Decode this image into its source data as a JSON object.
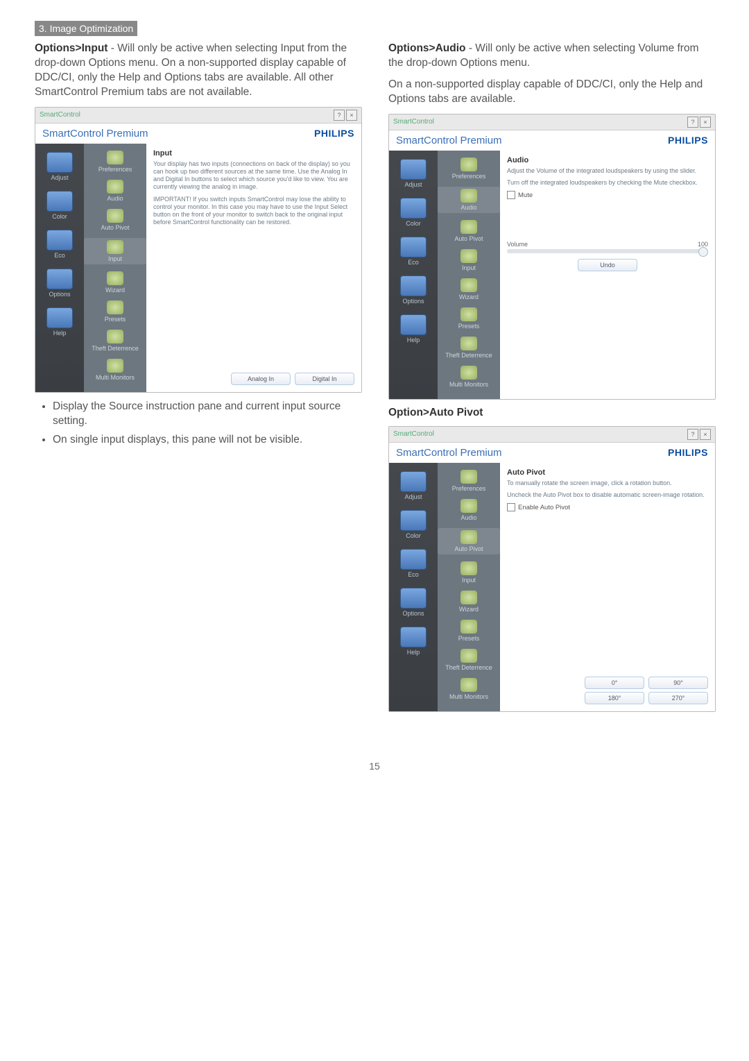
{
  "section_header": "3. Image Optimization",
  "left": {
    "heading_strong": "Options>Input",
    "heading_rest": " - Will only be active when selecting Input from the drop-down Options menu. On a non-supported display capable of DDC/CI, only the Help and Options tabs are available. All other SmartControl Premium tabs are not available.",
    "bullets": [
      "Display the Source instruction pane and current input source setting.",
      "On single input displays, this pane will not be visible."
    ],
    "screenshot": {
      "window_title": "SmartControl",
      "title": "SmartControl Premium",
      "brand": "PHILIPS",
      "leftnav": [
        "Adjust",
        "Color",
        "Eco",
        "Options",
        "Help"
      ],
      "midnav": [
        "Preferences",
        "Audio",
        "Auto Pivot",
        "Input",
        "Wizard",
        "Presets",
        "Theft Deterrence",
        "Multi Monitors"
      ],
      "panel_title": "Input",
      "panel_p1": "Your display has two inputs (connections on back of the display) so you can hook up two different sources at the same time. Use the Analog In and Digital In buttons to select which source you'd like to view. You are currently viewing the analog in image.",
      "panel_p2": "IMPORTANT! If you switch inputs SmartControl may lose the ability to control your monitor. In this case you may have to use the Input Select button on the front of your monitor to switch back to the original input before SmartControl functionality can be restored.",
      "buttons": [
        "Analog In",
        "Digital In"
      ]
    }
  },
  "right": {
    "heading_strong": "Options>Audio",
    "heading_rest": " - Will only be active when selecting Volume from the drop-down Options menu.",
    "para2": "On a non-supported display capable of DDC/CI, only the Help and Options tabs are available.",
    "screenshot_audio": {
      "window_title": "SmartControl",
      "title": "SmartControl Premium",
      "brand": "PHILIPS",
      "leftnav": [
        "Adjust",
        "Color",
        "Eco",
        "Options",
        "Help"
      ],
      "midnav": [
        "Preferences",
        "Audio",
        "Auto Pivot",
        "Input",
        "Wizard",
        "Presets",
        "Theft Deterrence",
        "Multi Monitors"
      ],
      "panel_title": "Audio",
      "panel_p1": "Adjust the Volume of the integrated loudspeakers by using the slider.",
      "panel_p2": "Turn off the integrated loudspeakers by checking the Mute checkbox.",
      "checkbox_label": "Mute",
      "slider_label": "Volume",
      "slider_value": "100",
      "undo_button": "Undo"
    },
    "sub_heading": "Option>Auto Pivot",
    "screenshot_pivot": {
      "window_title": "SmartControl",
      "title": "SmartControl Premium",
      "brand": "PHILIPS",
      "leftnav": [
        "Adjust",
        "Color",
        "Eco",
        "Options",
        "Help"
      ],
      "midnav": [
        "Preferences",
        "Audio",
        "Auto Pivot",
        "Input",
        "Wizard",
        "Presets",
        "Theft Deterrence",
        "Multi Monitors"
      ],
      "panel_title": "Auto Pivot",
      "panel_p1": "To manually rotate the screen image, click a rotation button.",
      "panel_p2": "Uncheck the Auto Pivot box to disable automatic screen-image rotation.",
      "checkbox_label": "Enable Auto Pivot",
      "buttons": [
        "0°",
        "90°",
        "180°",
        "270°"
      ]
    }
  },
  "page_number": "15"
}
